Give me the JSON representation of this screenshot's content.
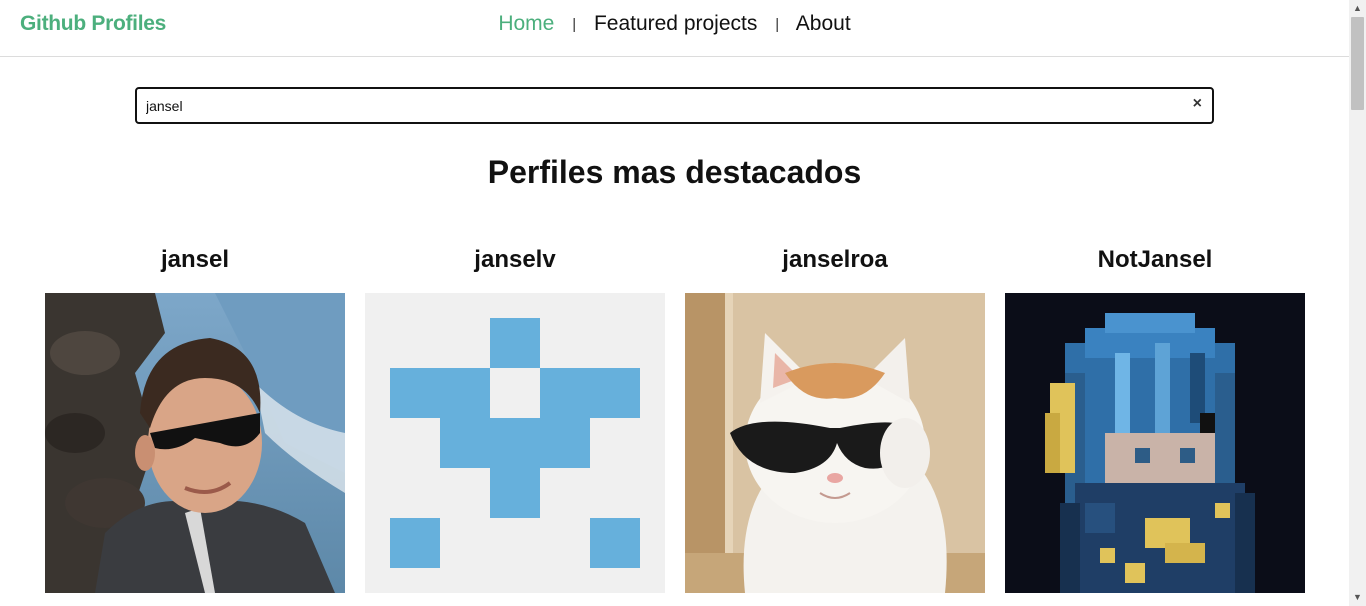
{
  "navbar": {
    "brand": "Github Profiles",
    "links": [
      {
        "label": "Home",
        "active": true
      },
      {
        "label": "Featured projects",
        "active": false
      },
      {
        "label": "About",
        "active": false
      }
    ],
    "separator": "|"
  },
  "search": {
    "value": "jansel",
    "clear_icon": "×"
  },
  "section": {
    "title": "Perfiles mas destacados"
  },
  "profiles": [
    {
      "username": "jansel",
      "avatar": "photo-man-sunglasses-beach"
    },
    {
      "username": "janselv",
      "avatar": "identicon-blue"
    },
    {
      "username": "janselroa",
      "avatar": "cat-with-sunglasses"
    },
    {
      "username": "NotJansel",
      "avatar": "pixel-art-character"
    }
  ],
  "colors": {
    "brand": "#4caf7d",
    "identicon": "#66b0dc",
    "identicon_bg": "#f0f0f0"
  }
}
